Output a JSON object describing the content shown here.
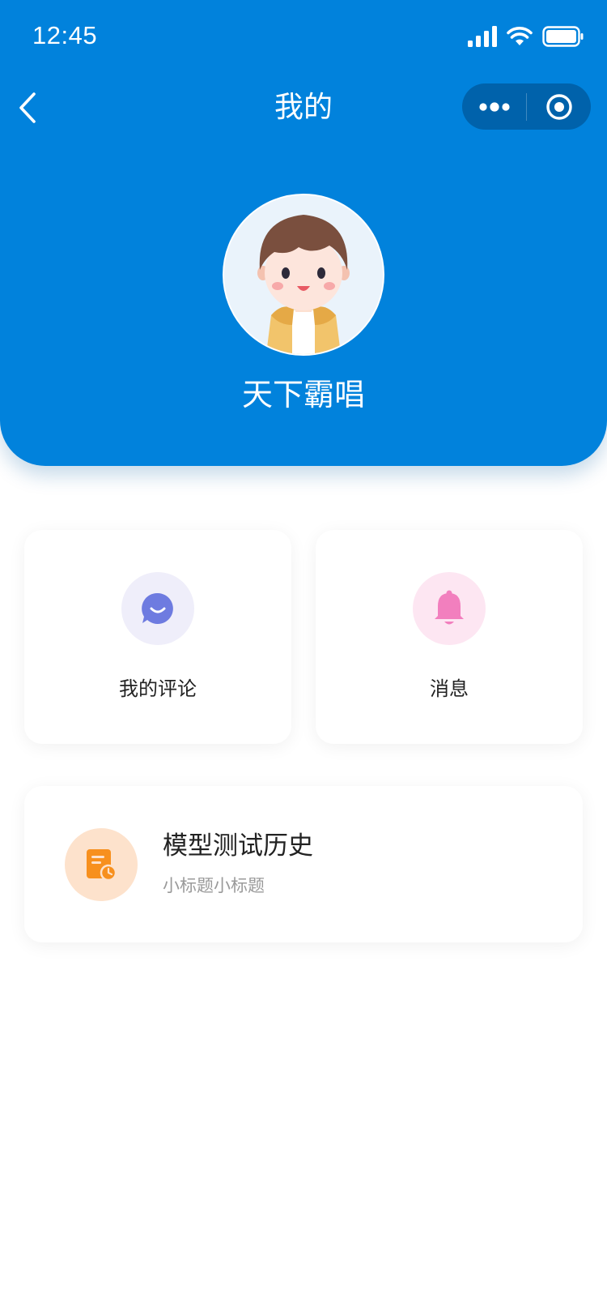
{
  "status_bar": {
    "time": "12:45",
    "icons": [
      "signal-icon",
      "wifi-icon",
      "battery-icon"
    ]
  },
  "nav": {
    "title": "我的",
    "back_icon": "chevron-left-icon",
    "capsule_icons": [
      "more-dots-icon",
      "target-icon"
    ]
  },
  "profile": {
    "username": "天下霸唱",
    "avatar_icon": "cartoon-avatar"
  },
  "cards": {
    "comments": {
      "label": "我的评论",
      "icon": "chat-bubble-icon",
      "icon_color": "#6e7be0",
      "circle_color": "#efeefa"
    },
    "messages": {
      "label": "消息",
      "icon": "bell-icon",
      "icon_color": "#f27fbe",
      "circle_color": "#fde6f2"
    }
  },
  "history": {
    "title": "模型测试历史",
    "subtitle": "小标题小标题",
    "icon": "history-doc-icon",
    "icon_color": "#f7901e",
    "circle_color": "#fde2cc"
  },
  "colors": {
    "header_blue": "#0182dc",
    "background": "#ffffff"
  }
}
